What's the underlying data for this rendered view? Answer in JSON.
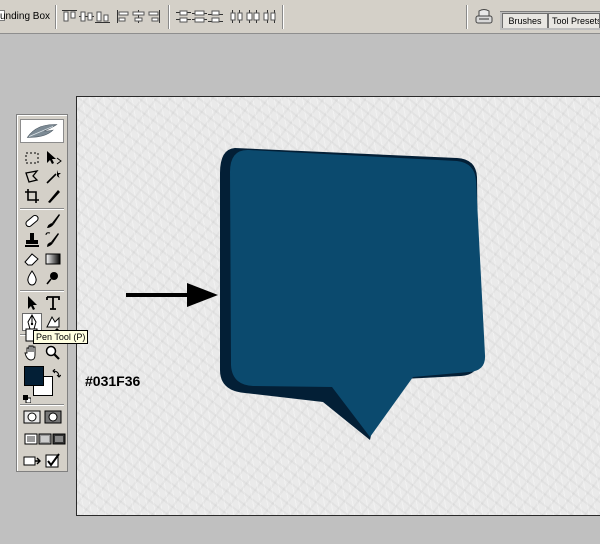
{
  "options_bar": {
    "bounding_box_label": "unding Box"
  },
  "palette_well": {
    "tabs": [
      "Brushes",
      "Tool Presets"
    ]
  },
  "toolbox": {
    "foreground_color": "#031F36",
    "background_color": "#FFFFFF"
  },
  "tooltip": {
    "text": "Pen Tool (P)"
  },
  "canvas": {
    "color_label": "#031F36",
    "bubble_face_color": "#0B4A6E",
    "bubble_shadow_color": "#031F36"
  }
}
